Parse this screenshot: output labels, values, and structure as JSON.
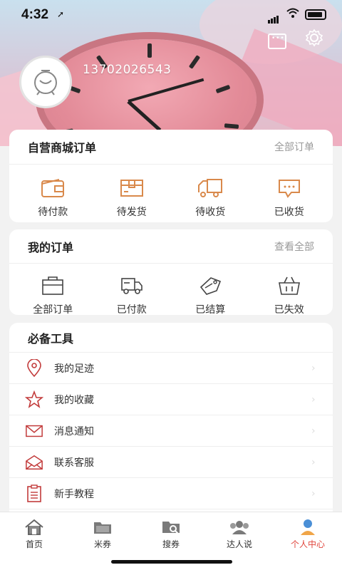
{
  "status_bar": {
    "time": "4:32",
    "location_glyph": "➚"
  },
  "header": {
    "phone": "13702026543"
  },
  "mall_orders": {
    "title": "自营商城订单",
    "link": "全部订单",
    "items": [
      {
        "label": "待付款",
        "icon": "wallet-icon"
      },
      {
        "label": "待发货",
        "icon": "package-icon"
      },
      {
        "label": "待收货",
        "icon": "truck-icon"
      },
      {
        "label": "已收货",
        "icon": "chat-box-icon"
      }
    ]
  },
  "my_orders": {
    "title": "我的订单",
    "link": "查看全部",
    "items": [
      {
        "label": "全部订单",
        "icon": "bag-icon"
      },
      {
        "label": "已付款",
        "icon": "delivery-truck-icon"
      },
      {
        "label": "已结算",
        "icon": "tag-icon"
      },
      {
        "label": "已失效",
        "icon": "basket-icon"
      }
    ]
  },
  "tools": {
    "title": "必备工具",
    "items": [
      {
        "label": "我的足迹",
        "icon": "location-pin-icon"
      },
      {
        "label": "我的收藏",
        "icon": "star-icon"
      },
      {
        "label": "消息通知",
        "icon": "envelope-icon"
      },
      {
        "label": "联系客服",
        "icon": "open-envelope-icon"
      },
      {
        "label": "新手教程",
        "icon": "document-icon"
      }
    ]
  },
  "tabbar": {
    "items": [
      {
        "label": "首页",
        "icon": "home-icon"
      },
      {
        "label": "米券",
        "icon": "folder-icon"
      },
      {
        "label": "搜券",
        "icon": "search-folder-icon"
      },
      {
        "label": "达人说",
        "icon": "group-icon"
      },
      {
        "label": "个人中心",
        "icon": "user-icon",
        "active": true
      }
    ]
  },
  "colors": {
    "accent_orange": "#d9894b",
    "active_tab": "#e0453c",
    "tool_icon": "#c23b3b"
  }
}
